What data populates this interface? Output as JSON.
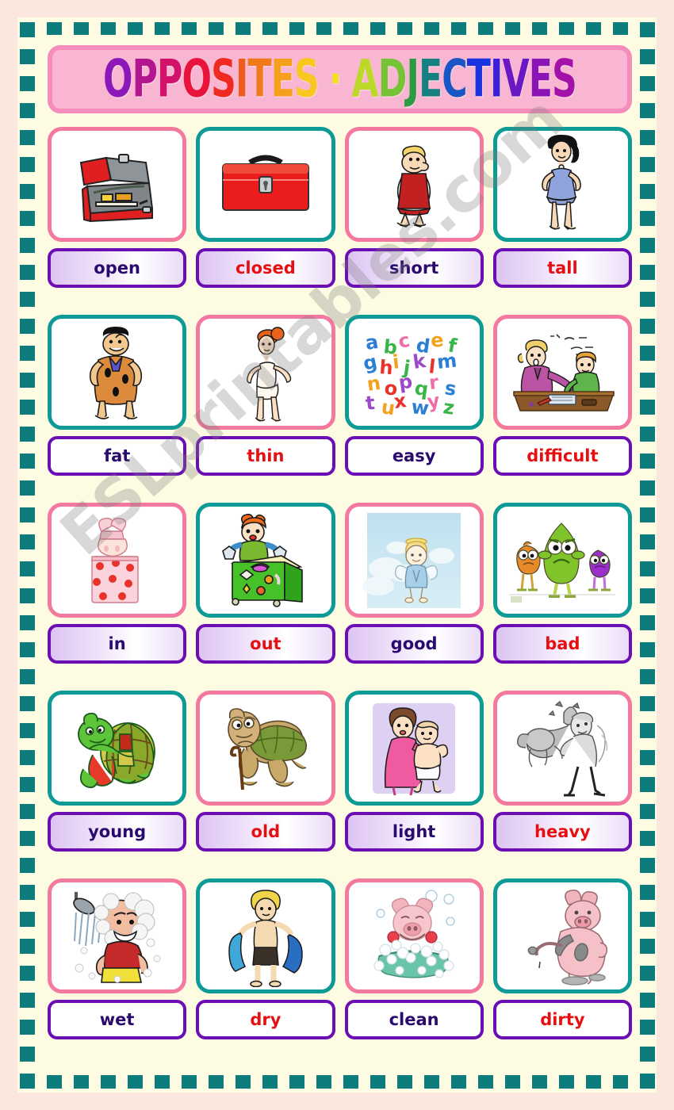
{
  "title": {
    "full_text": "OPPOSITES - ADJECTIVES",
    "letters": [
      {
        "ch": "O",
        "color": "#8c18b8"
      },
      {
        "ch": "P",
        "color": "#b3148f"
      },
      {
        "ch": "P",
        "color": "#d1116a"
      },
      {
        "ch": "O",
        "color": "#e8143c"
      },
      {
        "ch": "S",
        "color": "#ee2a22"
      },
      {
        "ch": "I",
        "color": "#f05a1b"
      },
      {
        "ch": "T",
        "color": "#f2791a"
      },
      {
        "ch": "E",
        "color": "#f5a01c"
      },
      {
        "ch": "S",
        "color": "#f8c821"
      },
      {
        "ch": " ",
        "color": "#f8c821"
      },
      {
        "ch": "·",
        "color": "#f4e01e"
      },
      {
        "ch": " ",
        "color": "#f4e01e"
      },
      {
        "ch": "A",
        "color": "#bcd92a"
      },
      {
        "ch": "D",
        "color": "#76c436"
      },
      {
        "ch": "J",
        "color": "#2f9a44"
      },
      {
        "ch": "E",
        "color": "#15807f"
      },
      {
        "ch": "C",
        "color": "#1756c4"
      },
      {
        "ch": "T",
        "color": "#1a33e0"
      },
      {
        "ch": "I",
        "color": "#3b1fd6"
      },
      {
        "ch": "V",
        "color": "#6a18c4"
      },
      {
        "ch": "E",
        "color": "#8a14b5"
      },
      {
        "ch": "S",
        "color": "#a411a8"
      }
    ]
  },
  "watermark": "ESLprintables.com",
  "colors": {
    "page_background": "#fbe7dd",
    "panel_background": "#fdfbe2",
    "frame_dash": "#0c7c7c",
    "banner_fill": "#f9b6d2",
    "banner_border": "#f58cbb",
    "card_border_pink": "#f3799f",
    "card_border_teal": "#0e9a96",
    "word_border": "#6b0fb5",
    "word_text_purple": "#2b0a6e",
    "word_text_red": "#e60f12"
  },
  "rows": [
    {
      "cards": [
        {
          "label": "open",
          "label_color": "purple",
          "border": "pink",
          "box_style": "grad",
          "icon": "open-toolbox-icon"
        },
        {
          "label": "closed",
          "label_color": "red",
          "border": "teal",
          "box_style": "grad",
          "icon": "closed-toolbox-icon"
        },
        {
          "label": "short",
          "label_color": "purple",
          "border": "pink",
          "box_style": "grad",
          "icon": "short-man-icon"
        },
        {
          "label": "tall",
          "label_color": "red",
          "border": "teal",
          "box_style": "grad",
          "icon": "tall-woman-icon"
        }
      ]
    },
    {
      "cards": [
        {
          "label": "fat",
          "label_color": "purple",
          "border": "teal",
          "box_style": "plain",
          "icon": "fat-man-icon"
        },
        {
          "label": "thin",
          "label_color": "red",
          "border": "pink",
          "box_style": "plain",
          "icon": "thin-woman-icon"
        },
        {
          "label": "easy",
          "label_color": "purple",
          "border": "teal",
          "box_style": "plain",
          "icon": "alphabet-letters-icon"
        },
        {
          "label": "difficult",
          "label_color": "red",
          "border": "pink",
          "box_style": "plain",
          "icon": "math-tutoring-icon"
        }
      ]
    },
    {
      "cards": [
        {
          "label": "in",
          "label_color": "purple",
          "border": "pink",
          "box_style": "grad",
          "icon": "cat-in-box-icon"
        },
        {
          "label": "out",
          "label_color": "red",
          "border": "teal",
          "box_style": "grad",
          "icon": "jack-in-the-box-icon"
        },
        {
          "label": "good",
          "label_color": "purple",
          "border": "pink",
          "box_style": "grad",
          "icon": "angel-child-icon"
        },
        {
          "label": "bad",
          "label_color": "red",
          "border": "teal",
          "box_style": "grad",
          "icon": "grumpy-monsters-icon"
        }
      ]
    },
    {
      "cards": [
        {
          "label": "young",
          "label_color": "purple",
          "border": "teal",
          "box_style": "grad",
          "icon": "young-turtle-icon"
        },
        {
          "label": "old",
          "label_color": "red",
          "border": "pink",
          "box_style": "grad",
          "icon": "old-turtle-icon"
        },
        {
          "label": "light",
          "label_color": "purple",
          "border": "teal",
          "box_style": "grad",
          "icon": "mother-holding-baby-icon"
        },
        {
          "label": "heavy",
          "label_color": "red",
          "border": "pink",
          "box_style": "grad",
          "icon": "man-carrying-elephant-icon"
        }
      ]
    },
    {
      "cards": [
        {
          "label": "wet",
          "label_color": "purple",
          "border": "pink",
          "box_style": "plain",
          "icon": "man-in-shower-icon"
        },
        {
          "label": "dry",
          "label_color": "red",
          "border": "teal",
          "box_style": "plain",
          "icon": "boy-with-towel-icon"
        },
        {
          "label": "clean",
          "label_color": "purple",
          "border": "pink",
          "box_style": "plain",
          "icon": "pig-in-bath-icon"
        },
        {
          "label": "dirty",
          "label_color": "red",
          "border": "teal",
          "box_style": "plain",
          "icon": "dirty-pig-icon"
        }
      ]
    }
  ]
}
